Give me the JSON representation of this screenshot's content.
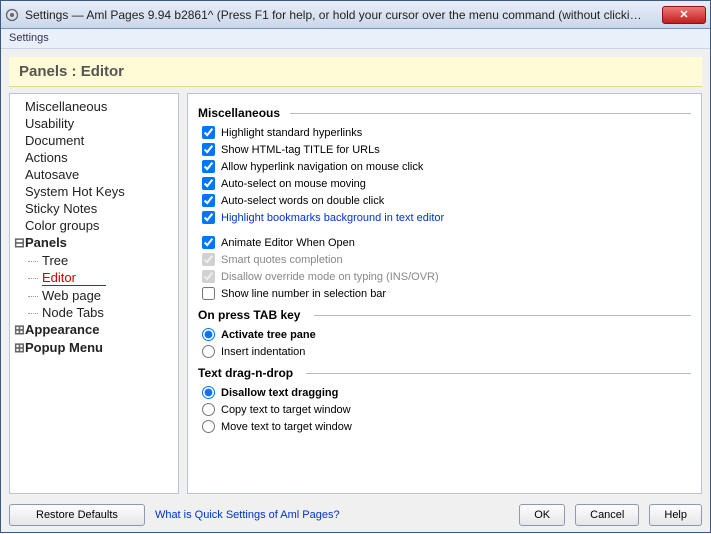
{
  "window": {
    "title": "Settings  —  Aml Pages 9.94 b2861^ (Press F1 for help, or hold your cursor over the menu command (without clicki…",
    "menulabel": "Settings"
  },
  "header": "Panels : Editor",
  "tree": {
    "items": [
      {
        "label": "Miscellaneous",
        "bold": false,
        "exp": ""
      },
      {
        "label": "Usability",
        "bold": false,
        "exp": ""
      },
      {
        "label": "Document",
        "bold": false,
        "exp": ""
      },
      {
        "label": "Actions",
        "bold": false,
        "exp": ""
      },
      {
        "label": "Autosave",
        "bold": false,
        "exp": ""
      },
      {
        "label": "System Hot Keys",
        "bold": false,
        "exp": ""
      },
      {
        "label": "Sticky Notes",
        "bold": false,
        "exp": ""
      },
      {
        "label": "Color groups",
        "bold": false,
        "exp": ""
      },
      {
        "label": "Panels",
        "bold": true,
        "exp": "⊟",
        "children": [
          {
            "label": "Tree"
          },
          {
            "label": "Editor",
            "selected": true
          },
          {
            "label": "Web page"
          },
          {
            "label": "Node Tabs"
          }
        ]
      },
      {
        "label": "Appearance",
        "bold": true,
        "exp": "⊞"
      },
      {
        "label": "Popup Menu",
        "bold": true,
        "exp": "⊞"
      }
    ]
  },
  "panel": {
    "groups": [
      {
        "title": "Miscellaneous",
        "tw": "92px",
        "opts": [
          {
            "type": "checkbox",
            "label": "Highlight standard hyperlinks",
            "checked": true
          },
          {
            "type": "checkbox",
            "label": "Show HTML-tag TITLE for URLs",
            "checked": true
          },
          {
            "type": "checkbox",
            "label": "Allow hyperlink navigation on mouse click",
            "checked": true
          },
          {
            "type": "checkbox",
            "label": "Auto-select on mouse moving",
            "checked": true
          },
          {
            "type": "checkbox",
            "label": "Auto-select words on double click",
            "checked": true
          },
          {
            "type": "checkbox",
            "label": "Highlight bookmarks background in text editor",
            "checked": true,
            "link": true
          }
        ]
      },
      {
        "title": "",
        "tw": "0px",
        "opts": [
          {
            "type": "checkbox",
            "label": "Animate Editor When Open",
            "checked": true
          },
          {
            "type": "checkbox",
            "label": "Smart quotes completion",
            "checked": true,
            "disabled": true
          },
          {
            "type": "checkbox",
            "label": "Disallow override mode on typing (INS/OVR)",
            "checked": true,
            "disabled": true
          },
          {
            "type": "checkbox",
            "label": "Show line number in selection bar",
            "checked": false
          }
        ]
      },
      {
        "title": "On press TAB key",
        "tw": "116px",
        "opts": [
          {
            "type": "radio",
            "name": "tab",
            "label": "Activate tree pane",
            "checked": true,
            "bold": true
          },
          {
            "type": "radio",
            "name": "tab",
            "label": "Insert indentation",
            "checked": false
          }
        ]
      },
      {
        "title": "Text drag-n-drop",
        "tw": "108px",
        "opts": [
          {
            "type": "radio",
            "name": "dnd",
            "label": "Disallow text dragging",
            "checked": true,
            "bold": true
          },
          {
            "type": "radio",
            "name": "dnd",
            "label": "Copy text to target window",
            "checked": false
          },
          {
            "type": "radio",
            "name": "dnd",
            "label": "Move text to target window",
            "checked": false
          }
        ]
      }
    ]
  },
  "footer": {
    "restore": "Restore Defaults",
    "link": "What is Quick Settings of Aml Pages?",
    "ok": "OK",
    "cancel": "Cancel",
    "help": "Help"
  }
}
